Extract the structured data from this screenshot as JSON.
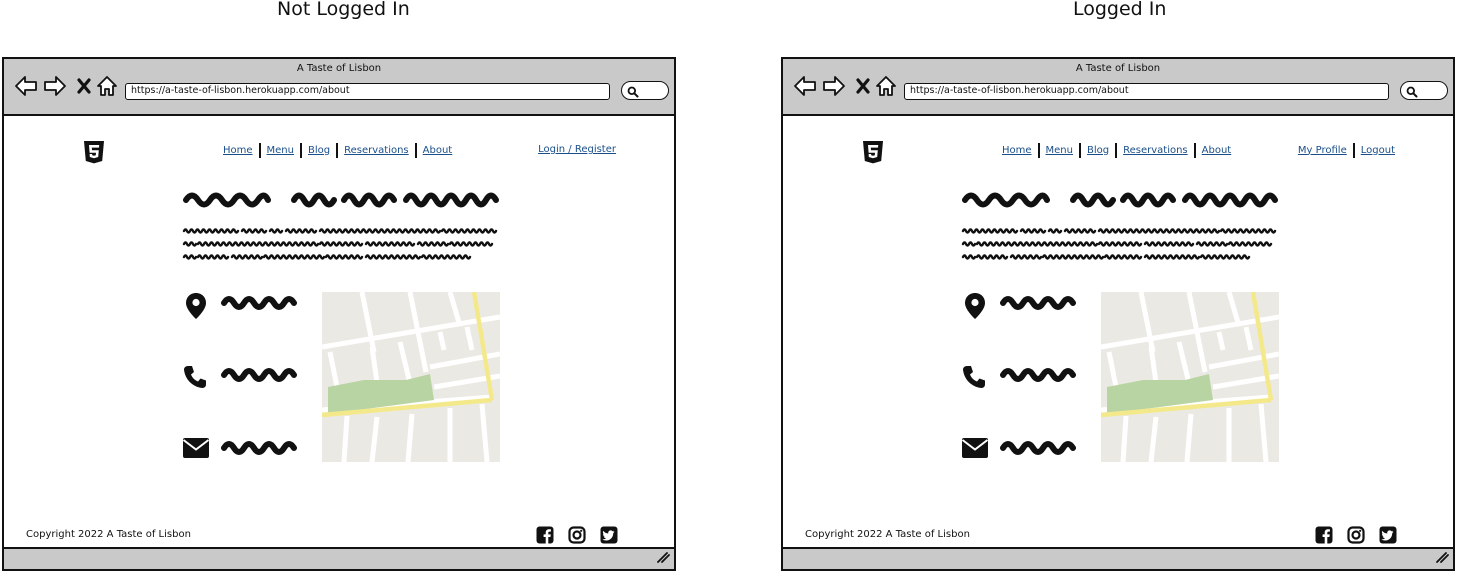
{
  "columns": [
    {
      "id": "not-logged-in",
      "heading": "Not Logged In",
      "window_title": "A Taste of Lisbon",
      "url": "https://a-taste-of-lisbon.herokuapp.com/about",
      "nav": [
        "Home",
        "Menu",
        "Blog",
        "Reservations",
        "About"
      ],
      "auth": [
        "Login / Register"
      ],
      "footer_copyright": "Copyright 2022 A Taste of Lisbon"
    },
    {
      "id": "logged-in",
      "heading": "Logged In",
      "window_title": "A Taste of Lisbon",
      "url": "https://a-taste-of-lisbon.herokuapp.com/about",
      "nav": [
        "Home",
        "Menu",
        "Blog",
        "Reservations",
        "About"
      ],
      "auth": [
        "My Profile",
        "Logout"
      ],
      "footer_copyright": "Copyright 2022 A Taste of Lisbon"
    }
  ],
  "icons": {
    "browser": [
      "back-arrow-icon",
      "forward-arrow-icon",
      "stop-icon",
      "home-icon",
      "search-icon"
    ],
    "logo": "html5-logo-icon",
    "contact": [
      "location-pin-icon",
      "phone-icon",
      "envelope-icon"
    ],
    "social": [
      "facebook-icon",
      "instagram-icon",
      "twitter-icon"
    ],
    "statusbar": "resize-grip-icon"
  },
  "colors": {
    "chrome": "#c9c9c9",
    "link": "#1a4f8a",
    "map_land": "#ebe9e3",
    "map_park": "#b9d4a3",
    "map_road_major": "#f4e98a",
    "map_road_minor": "#ffffff"
  }
}
